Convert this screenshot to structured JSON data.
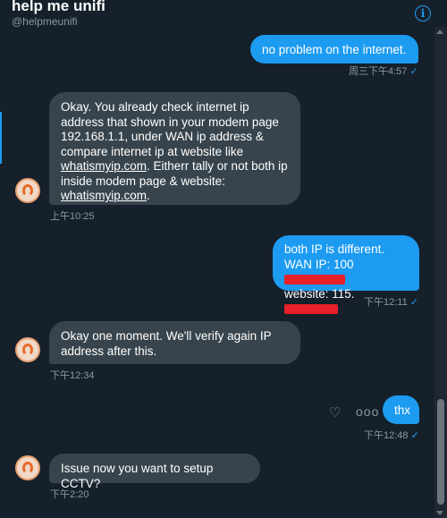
{
  "header": {
    "title": "help me unifi",
    "handle": "@helpmeunifi",
    "info_icon": "i"
  },
  "messages": [
    {
      "dir": "sent",
      "text": "no problem on the internet.",
      "time": "周三下午4:57",
      "check": "✓"
    },
    {
      "dir": "recv",
      "lines": [
        "Okay. You already check internet ip",
        "address that shown in your modem page",
        "192.168.1.1, under WAN ip address &",
        "compare internet ip at website like",
        "whatismyip.com",
        ". Eitherr tally or not both ip",
        "inside modem page & website:",
        "whatismyip.com",
        "."
      ],
      "time": "上午10:25"
    },
    {
      "dir": "sent",
      "lines": [
        "both IP is different.",
        "WAN IP: 100",
        "website: 115."
      ],
      "time": "下午12:11",
      "check": "✓"
    },
    {
      "dir": "recv",
      "lines": [
        "Okay one moment. We'll verify again IP",
        "address after this."
      ],
      "time": "下午12:34"
    },
    {
      "dir": "sent",
      "text": "thx",
      "time": "下午12:48",
      "check": "✓"
    },
    {
      "dir": "recv",
      "text": "Issue now you want to setup CCTV?",
      "time": "下午2:20"
    }
  ],
  "actions": {
    "heart_icon": "♡",
    "more_icon": "ooo"
  }
}
